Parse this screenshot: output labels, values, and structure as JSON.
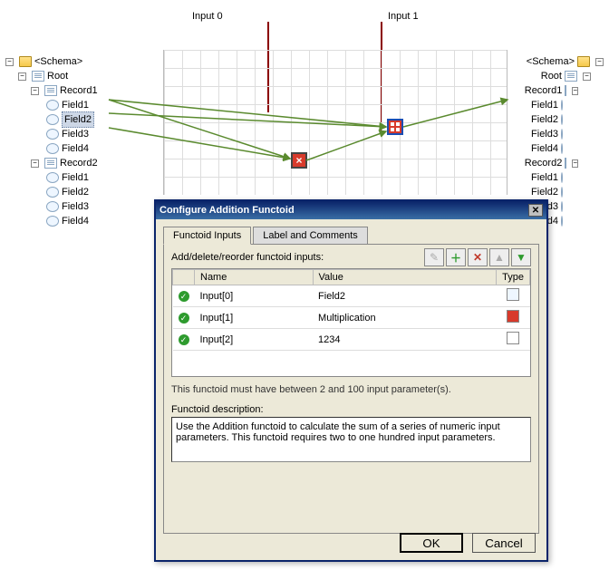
{
  "callouts": {
    "input0": "Input 0",
    "input1": "Input 1"
  },
  "leftTree": {
    "schema": "<Schema>",
    "root": "Root",
    "record1": "Record1",
    "r1fields": [
      "Field1",
      "Field2",
      "Field3",
      "Field4"
    ],
    "record2": "Record2",
    "r2fields": [
      "Field1",
      "Field2",
      "Field3",
      "Field4"
    ],
    "selected": "Field2"
  },
  "rightTree": {
    "schema": "<Schema>",
    "root": "Root",
    "record1": "Record1",
    "r1fields": [
      "Field1",
      "Field2",
      "Field3",
      "Field4"
    ],
    "record2": "Record2",
    "r2fields": [
      "Field1",
      "Field2",
      "Field3",
      "Field4"
    ]
  },
  "dialog": {
    "title": "Configure Addition Functoid",
    "tabs": {
      "inputs": "Functoid Inputs",
      "label": "Label and Comments"
    },
    "activeTab": "inputs",
    "instruction": "Add/delete/reorder functoid inputs:",
    "columns": {
      "name": "Name",
      "value": "Value",
      "type": "Type"
    },
    "rows": [
      {
        "name": "Input[0]",
        "value": "Field2",
        "type": "schema"
      },
      {
        "name": "Input[1]",
        "value": "Multiplication",
        "type": "func"
      },
      {
        "name": "Input[2]",
        "value": "1234",
        "type": "const"
      }
    ],
    "note": "This functoid must have between 2 and 100 input parameter(s).",
    "descLabel": "Functoid description:",
    "description": "Use the Addition functoid to calculate the sum of a series of numeric input parameters. This functoid requires two to one hundred input parameters.",
    "buttons": {
      "ok": "OK",
      "cancel": "Cancel"
    }
  }
}
